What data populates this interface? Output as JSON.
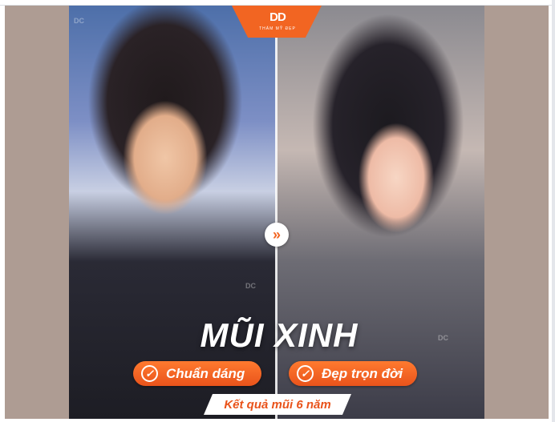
{
  "logo": {
    "mark": "DD",
    "subtitle": "THẨM MỸ ĐẸP"
  },
  "comparison": {
    "before_label": "",
    "after_label": ""
  },
  "headline": "MŨI XINH",
  "badges": [
    {
      "label": "Chuẩn dáng",
      "icon": "check-circle-icon"
    },
    {
      "label": "Đẹp trọn đời",
      "icon": "check-circle-icon"
    }
  ],
  "result_label": "Kết quả mũi 6 năm",
  "arrow_icon": "double-chevron-right-icon",
  "colors": {
    "accent": "#f26522",
    "background_side": "#ae9c93",
    "text_light": "#ffffff"
  }
}
